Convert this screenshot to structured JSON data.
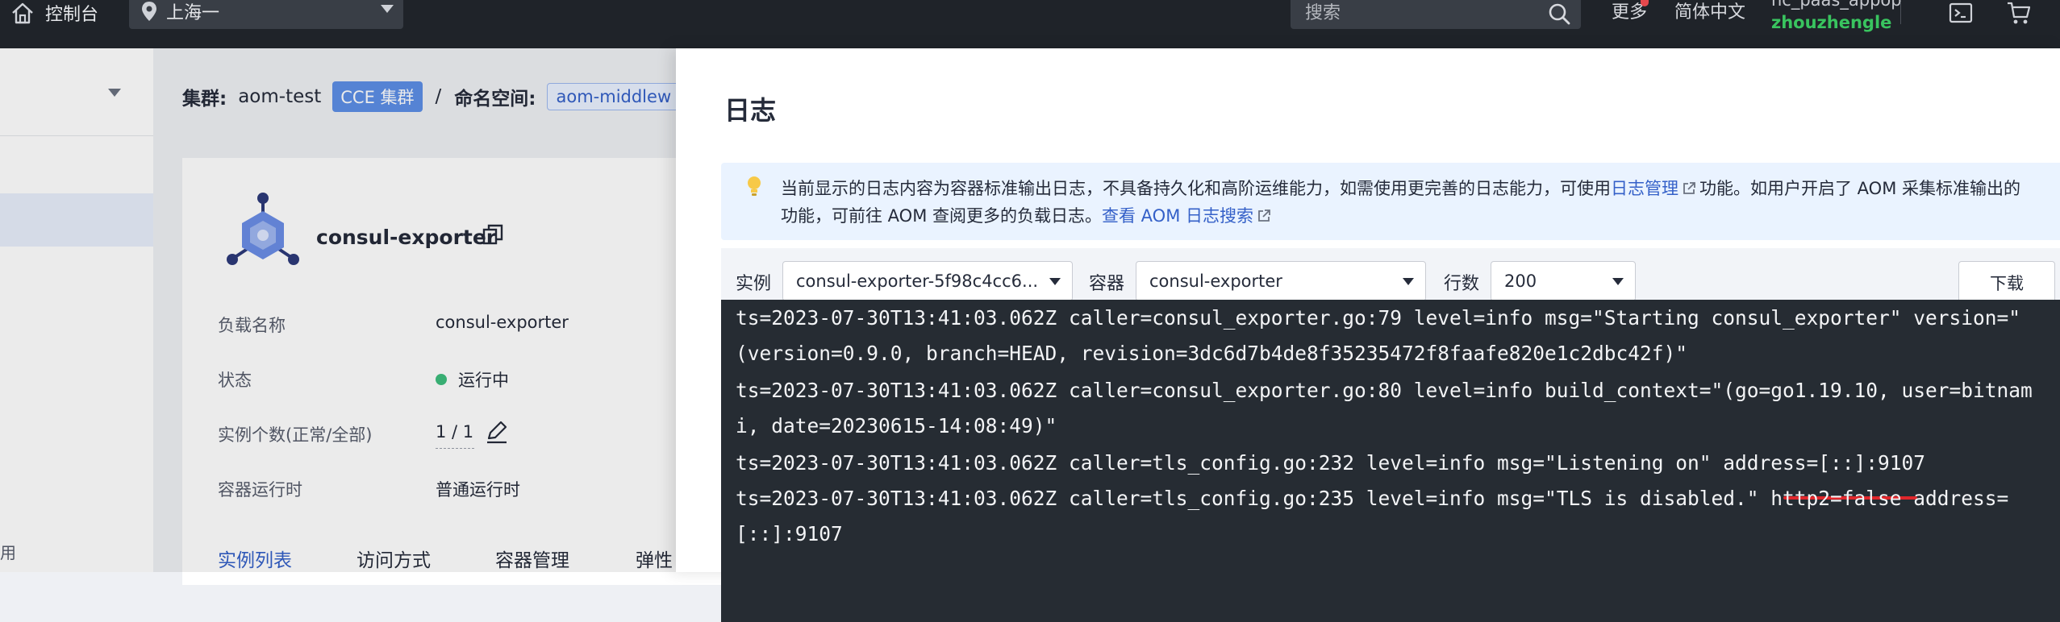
{
  "topbar": {
    "console_label": "控制台",
    "region": "上海一",
    "search_placeholder": "搜索",
    "more": "更多",
    "language": "简体中文",
    "user_line1": "hc_paas_appop",
    "user_line2": "zhouzhengle",
    "icons": [
      "home-icon",
      "location-pin-icon",
      "search-icon",
      "terminal-icon",
      "cart-icon"
    ]
  },
  "sidebar": {
    "tail_text": "用"
  },
  "breadcrumb": {
    "cluster_key": "集群:",
    "cluster_value": "aom-test",
    "cluster_tag": "CCE 集群",
    "separator": "/",
    "namespace_key": "命名空间:",
    "namespace_tag": "aom-middlew"
  },
  "workload": {
    "name": "consul-exporter",
    "fields": [
      {
        "key": "负载名称",
        "value": "consul-exporter"
      },
      {
        "key": "状态",
        "value": "运行中"
      },
      {
        "key": "实例个数(正常/全部)",
        "value": "1 / 1"
      },
      {
        "key": "容器运行时",
        "value": "普通运行时"
      }
    ],
    "tabs": [
      "实例列表",
      "访问方式",
      "容器管理",
      "弹性"
    ],
    "status_color": "#3dbd7d"
  },
  "log_drawer": {
    "title": "日志",
    "notice": {
      "line1_prefix": "当前显示的日志内容为容器标准输出日志，不具备持久化和高阶运维能力，如需使用更完善的日志能力，可使用",
      "line1_link": "日志管理",
      "line1_suffix": "功能。如用户开启了 AOM 采集标准输出的",
      "line2_prefix": "功能，可前往 AOM 查阅更多的负载日志。",
      "line2_link": "查看 AOM 日志搜索"
    },
    "filters": {
      "instance_label": "实例",
      "instance_value": "consul-exporter-5f98c4cc6...",
      "container_label": "容器",
      "container_value": "consul-exporter",
      "lines_label": "行数",
      "lines_value": "200",
      "download_label": "下载"
    },
    "log_lines": [
      "ts=2023-07-30T13:41:03.062Z caller=consul_exporter.go:79 level=info msg=\"Starting consul_exporter\" version=\"",
      "(version=0.9.0, branch=HEAD, revision=3dc6d7b4de8f35235472f8faafe820e1c2dbc42f)\"",
      "ts=2023-07-30T13:41:03.062Z caller=consul_exporter.go:80 level=info build_context=\"(go=go1.19.10, user=bitnam",
      "i, date=20230615-14:08:49)\"",
      "ts=2023-07-30T13:41:03.062Z caller=tls_config.go:232 level=info msg=\"Listening on\" address=[::]:9107",
      "ts=2023-07-30T13:41:03.062Z caller=tls_config.go:235 level=info msg=\"TLS is disabled.\" http2=false address=",
      "[::]:9107"
    ],
    "highlight_color": "#e0262b"
  }
}
